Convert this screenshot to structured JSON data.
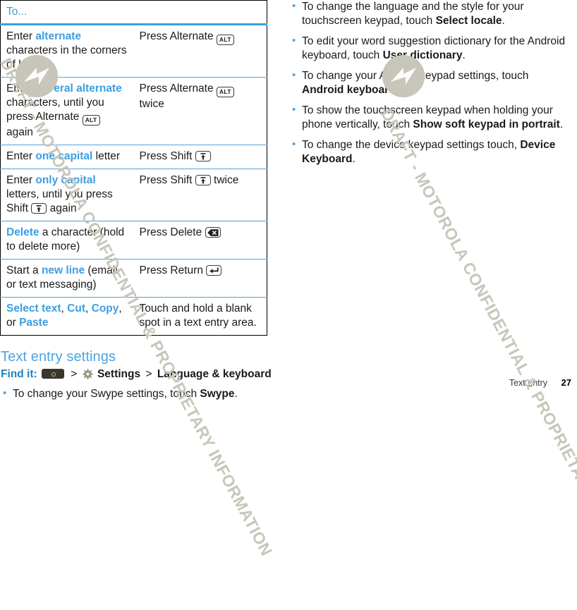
{
  "document": {
    "watermark_text": "DRAFT - MOTOROLA CONFIDENTIAL & PROPRIETARY INFORMATION",
    "accent_color": "#3c9fe0",
    "watermark_color": "#c8c6ba"
  },
  "table": {
    "header": "To...",
    "rows": [
      {
        "action_parts": [
          {
            "t": "Enter ",
            "style": "plain"
          },
          {
            "t": "alternate",
            "style": "hl"
          },
          {
            "t": " characters in the corners of keys",
            "style": "plain"
          }
        ],
        "result_parts": [
          {
            "t": "Press Alternate ",
            "style": "plain"
          },
          {
            "t": "ALT",
            "style": "key-alt"
          }
        ]
      },
      {
        "action_parts": [
          {
            "t": "Enter ",
            "style": "plain"
          },
          {
            "t": "several alternate",
            "style": "hl"
          },
          {
            "t": " characters, until you press Alternate ",
            "style": "plain"
          },
          {
            "t": "ALT",
            "style": "key-alt"
          },
          {
            "t": " again",
            "style": "plain"
          }
        ],
        "result_parts": [
          {
            "t": "Press Alternate ",
            "style": "plain"
          },
          {
            "t": "ALT",
            "style": "key-alt"
          },
          {
            "t": " twice",
            "style": "plain"
          }
        ]
      },
      {
        "action_parts": [
          {
            "t": "Enter ",
            "style": "plain"
          },
          {
            "t": "one capital",
            "style": "hl"
          },
          {
            "t": " letter",
            "style": "plain"
          }
        ],
        "result_parts": [
          {
            "t": "Press Shift ",
            "style": "plain"
          },
          {
            "t": "shift-key-icon",
            "style": "key-shift"
          }
        ]
      },
      {
        "action_parts": [
          {
            "t": "Enter ",
            "style": "plain"
          },
          {
            "t": "only capital",
            "style": "hl"
          },
          {
            "t": " letters, until you press Shift ",
            "style": "plain"
          },
          {
            "t": "shift-key-icon",
            "style": "key-shift"
          },
          {
            "t": " again",
            "style": "plain"
          }
        ],
        "result_parts": [
          {
            "t": "Press Shift ",
            "style": "plain"
          },
          {
            "t": "shift-key-icon",
            "style": "key-shift"
          },
          {
            "t": " twice",
            "style": "plain"
          }
        ]
      },
      {
        "action_parts": [
          {
            "t": "Delete",
            "style": "hl"
          },
          {
            "t": " a character (hold to delete more)",
            "style": "plain"
          }
        ],
        "result_parts": [
          {
            "t": "Press Delete ",
            "style": "plain"
          },
          {
            "t": "delete-key-icon",
            "style": "key-delete"
          }
        ]
      },
      {
        "action_parts": [
          {
            "t": "Start a ",
            "style": "plain"
          },
          {
            "t": "new line",
            "style": "hl"
          },
          {
            "t": " (email or text messaging)",
            "style": "plain"
          }
        ],
        "result_parts": [
          {
            "t": "Press Return ",
            "style": "plain"
          },
          {
            "t": "return-key-icon",
            "style": "key-return"
          }
        ]
      },
      {
        "action_parts": [
          {
            "t": "Select text",
            "style": "hl"
          },
          {
            "t": ", ",
            "style": "plain"
          },
          {
            "t": "Cut",
            "style": "hl"
          },
          {
            "t": ", ",
            "style": "plain"
          },
          {
            "t": "Copy",
            "style": "hl"
          },
          {
            "t": ", or ",
            "style": "plain"
          },
          {
            "t": "Paste",
            "style": "hl"
          }
        ],
        "result_parts": [
          {
            "t": "Touch and hold a blank spot in a text entry area.",
            "style": "plain"
          }
        ]
      }
    ]
  },
  "text_entry_settings": {
    "title": "Text entry settings",
    "find_it_label": "Find it:",
    "home_key_icon": "home-key-icon",
    "gear_icon": "gear-icon",
    "settings_label": "Settings",
    "separator": ">",
    "destination_label": "Language & keyboard",
    "bullets": [
      [
        {
          "t": "To change your Swype settings, touch ",
          "style": "plain"
        },
        {
          "t": "Swype",
          "style": "bold"
        },
        {
          "t": ".",
          "style": "plain"
        }
      ]
    ]
  },
  "right_column": {
    "bullets": [
      [
        {
          "t": "To change the language and the style for your touchscreen keypad, touch ",
          "style": "plain"
        },
        {
          "t": "Select locale",
          "style": "bold"
        },
        {
          "t": ".",
          "style": "plain"
        }
      ],
      [
        {
          "t": "To edit your word suggestion dictionary for the Android keyboard, touch ",
          "style": "plain"
        },
        {
          "t": "User dictionary",
          "style": "bold"
        },
        {
          "t": ".",
          "style": "plain"
        }
      ],
      [
        {
          "t": "To change your Android keypad settings, touch ",
          "style": "plain"
        },
        {
          "t": "Android keyboard",
          "style": "bold"
        },
        {
          "t": ".",
          "style": "plain"
        }
      ],
      [
        {
          "t": "To show the touchscreen keypad when holding your phone vertically, touch ",
          "style": "plain"
        },
        {
          "t": "Show soft keypad in portrait",
          "style": "bold"
        },
        {
          "t": ".",
          "style": "plain"
        }
      ],
      [
        {
          "t": "To change the device keypad settings touch, ",
          "style": "plain"
        },
        {
          "t": "Device Keyboard",
          "style": "bold"
        },
        {
          "t": ".",
          "style": "plain"
        }
      ]
    ]
  },
  "footer": {
    "section": "Text entry",
    "page_number": "27"
  }
}
